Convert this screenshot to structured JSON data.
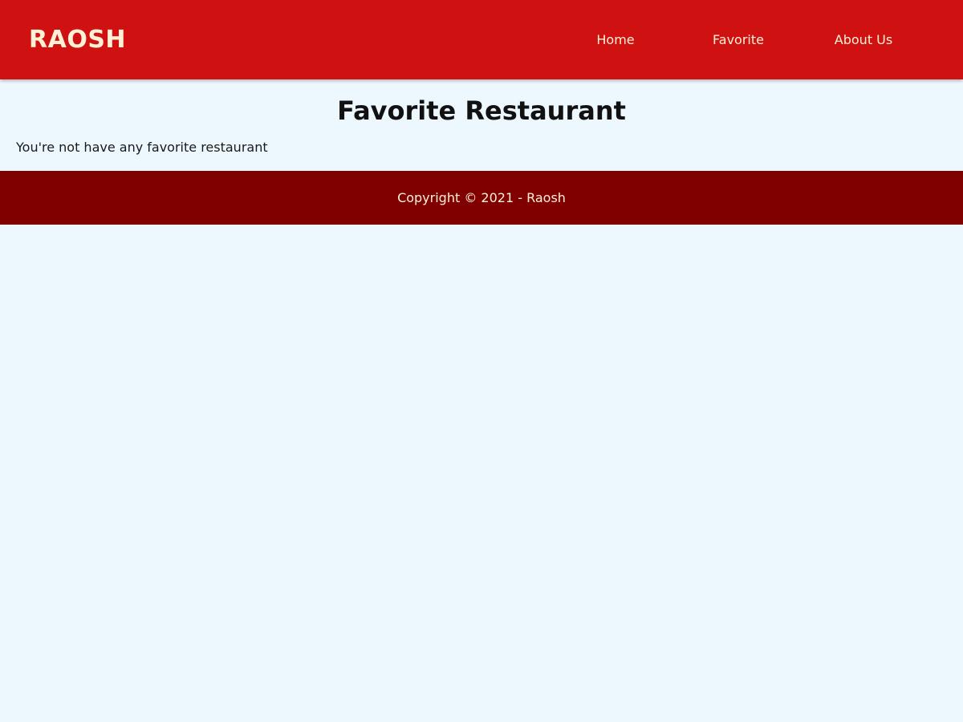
{
  "header": {
    "brand": "RAOSH",
    "nav": {
      "home": "Home",
      "favorite": "Favorite",
      "about": "About Us"
    }
  },
  "main": {
    "title": "Favorite Restaurant",
    "empty_message": "You're not have any favorite restaurant"
  },
  "footer": {
    "copyright": "Copyright © 2021 - Raosh"
  },
  "colors": {
    "header_bg": "#cf1111",
    "footer_bg": "#800000",
    "page_bg": "#ecf8fe",
    "header_text": "#fdf1d6"
  }
}
